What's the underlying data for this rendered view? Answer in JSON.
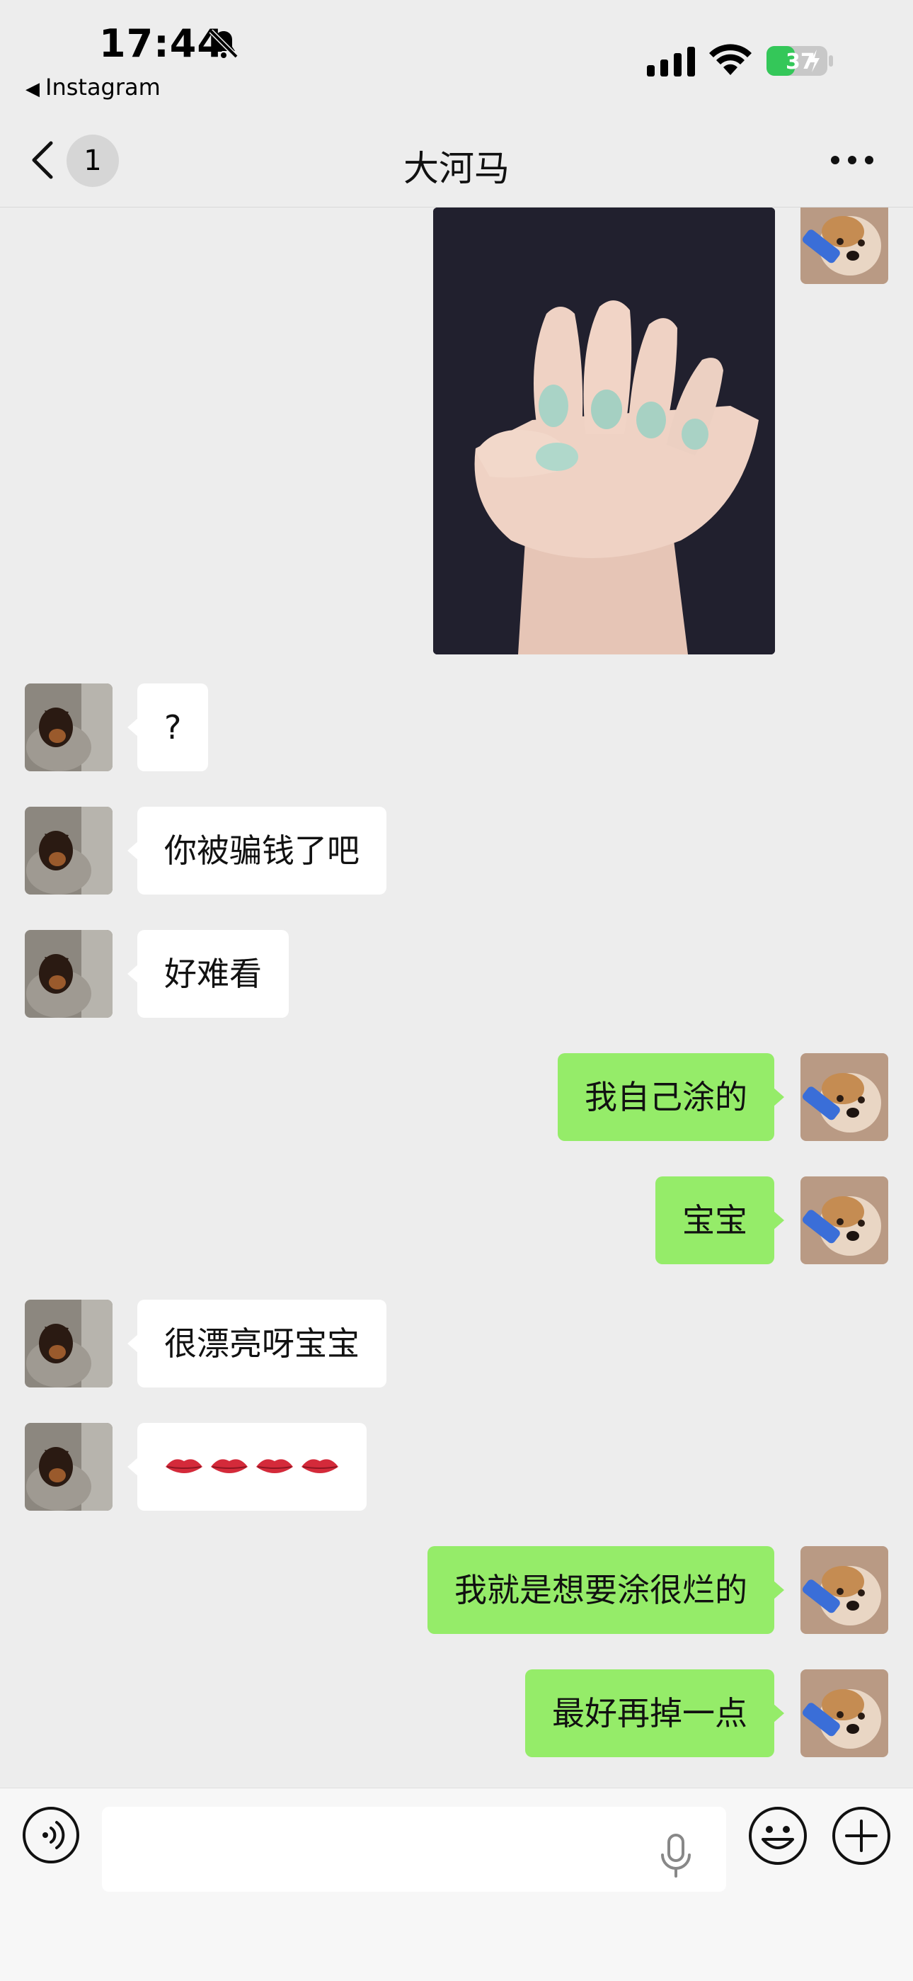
{
  "status_bar": {
    "time": "17:44",
    "back_app": "Instagram",
    "battery": "37"
  },
  "nav": {
    "unread_count": "1",
    "title": "大河马"
  },
  "messages": [
    {
      "sender": "friend",
      "text": "?"
    },
    {
      "sender": "friend",
      "text": "你被骗钱了吧"
    },
    {
      "sender": "friend",
      "text": "好难看"
    },
    {
      "sender": "me",
      "text": "我自己涂的"
    },
    {
      "sender": "me",
      "text": "宝宝"
    },
    {
      "sender": "friend",
      "text": "很漂亮呀宝宝"
    },
    {
      "sender": "friend",
      "text": "👄👄👄👄"
    },
    {
      "sender": "me",
      "text": "我就是想要涂很烂的"
    },
    {
      "sender": "me",
      "text": "最好再掉一点"
    }
  ],
  "input": {
    "value": "",
    "placeholder": ""
  },
  "icons": {
    "bell_muted": "bell-slash-icon",
    "voice": "voice-icon",
    "mic": "mic-icon",
    "emoji": "emoji-icon",
    "plus": "plus-icon",
    "more": "more-icon",
    "back": "chevron-left-icon"
  },
  "colors": {
    "my_bubble": "#95ec69",
    "friend_bubble": "#ffffff",
    "background": "#ededed",
    "battery": "#34c759"
  }
}
